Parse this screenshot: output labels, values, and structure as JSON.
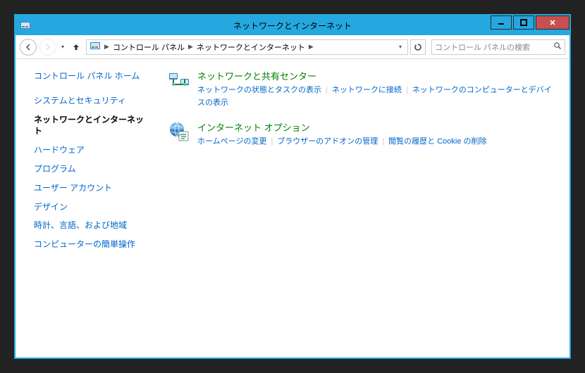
{
  "window": {
    "title": "ネットワークとインターネット"
  },
  "breadcrumb": {
    "items": [
      "コントロール パネル",
      "ネットワークとインターネット"
    ]
  },
  "search": {
    "placeholder": "コントロール パネルの検索"
  },
  "sidebar": {
    "home": "コントロール パネル ホーム",
    "items": [
      "システムとセキュリティ",
      "ネットワークとインターネット",
      "ハードウェア",
      "プログラム",
      "ユーザー アカウント",
      "デザイン",
      "時計、言語、および地域",
      "コンピューターの簡単操作"
    ],
    "active_index": 1
  },
  "categories": [
    {
      "icon": "network-sharing-icon",
      "title": "ネットワークと共有センター",
      "subs": [
        "ネットワークの状態とタスクの表示",
        "ネットワークに接続",
        "ネットワークのコンピューターとデバイスの表示"
      ]
    },
    {
      "icon": "internet-options-icon",
      "title": "インターネット オプション",
      "subs": [
        "ホームページの変更",
        "ブラウザーのアドオンの管理",
        "閲覧の履歴と Cookie の削除"
      ]
    }
  ]
}
